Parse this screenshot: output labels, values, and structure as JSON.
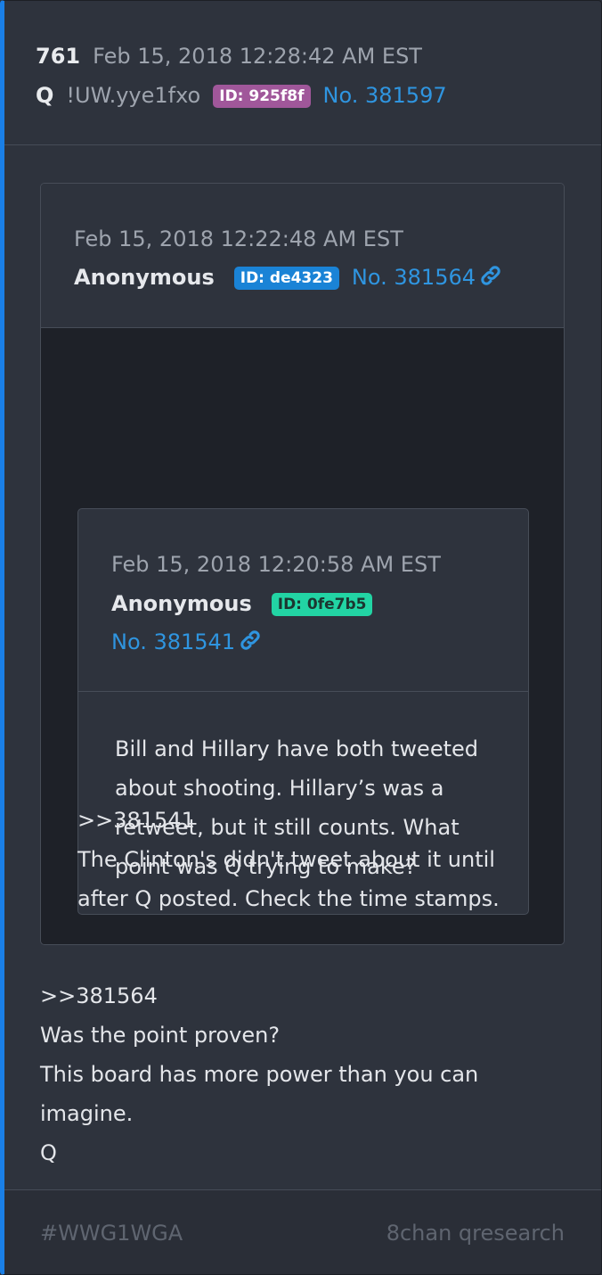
{
  "post": {
    "number": "761",
    "timestamp": "Feb 15, 2018 12:28:42 AM EST",
    "author": "Q",
    "tripcode": "!UW.yye1fxo",
    "id_label": "ID: 925f8f",
    "post_link": "No. 381597",
    "colors": {
      "accent_border": "#1a7fe6",
      "id_badge": "#a0579a",
      "link": "#2f95e0"
    }
  },
  "quote_outer": {
    "timestamp": "Feb 15, 2018 12:22:48 AM EST",
    "author": "Anonymous",
    "id_label": "ID: de4323",
    "post_link": "No. 381564",
    "link_icon": "link-icon",
    "id_color": "#1a83d6",
    "reply_ref": ">>381541",
    "text_lines": [
      "The Clinton's didn't tweet about it until",
      "after Q posted. Check the time stamps."
    ]
  },
  "quote_inner": {
    "timestamp": "Feb 15, 2018 12:20:58 AM EST",
    "author": "Anonymous",
    "id_label": "ID: 0fe7b5",
    "post_link": "No. 381541",
    "link_icon": "link-icon",
    "id_color": "#22d4a4",
    "text_lines": [
      "Bill and Hillary have both tweeted",
      "about shooting. Hillary’s was a",
      "retweet, but it still counts. What",
      "point was Q trying to make?"
    ]
  },
  "body": {
    "reply_ref": ">>381564",
    "lines": [
      "Was the point proven?",
      "This board has more power than you can",
      "imagine.",
      "Q"
    ]
  },
  "footer": {
    "hashtag": "#WWG1WGA",
    "source": "8chan qresearch"
  }
}
